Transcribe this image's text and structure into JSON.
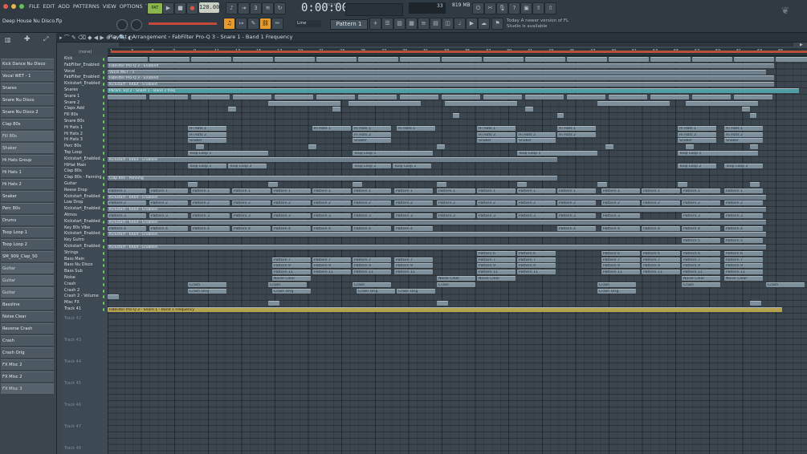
{
  "menu": [
    "FILE",
    "EDIT",
    "ADD",
    "PATTERNS",
    "VIEW",
    "OPTIONS",
    "TOOLS",
    "HELP"
  ],
  "transport": {
    "tempo": "120.000",
    "time": "0:00:00",
    "time_small": "m:s:cs",
    "mode_label": "Line",
    "pattern": "Pattern 1",
    "memory": "819 MB",
    "cpu_value": "33"
  },
  "project_name": "Deep House Nu Disco.flp",
  "news": "Today  A newer version of FL Studio is available",
  "playlist_title": "Playlist - Arrangement › FabFilter Pro-Q 3 - Snare 1 - Band 1 Frequency",
  "playlist_zoom": "(none)",
  "browser_items": [
    {
      "label": "Kick Dance Nu Disco",
      "wave": false
    },
    {
      "label": "Vocal WET - 1",
      "wave": false
    },
    {
      "label": "Snares",
      "wave": false
    },
    {
      "label": "Snare Nu Disco",
      "wave": false
    },
    {
      "label": "Snare Nu Disco 2",
      "wave": false
    },
    {
      "label": "Clap 80s",
      "wave": false
    },
    {
      "label": "Fill 80s",
      "wave": true
    },
    {
      "label": "Shaker",
      "wave": true
    },
    {
      "label": "Hi Hats Group",
      "wave": false
    },
    {
      "label": "Hi Hats 1",
      "wave": false
    },
    {
      "label": "Hi Hats 2",
      "wave": false
    },
    {
      "label": "Snaker",
      "wave": false
    },
    {
      "label": "Perc 80s",
      "wave": false
    },
    {
      "label": "Drums",
      "wave": false
    },
    {
      "label": "Toop Loop 1",
      "wave": false
    },
    {
      "label": "Toop Loop 2",
      "wave": false
    },
    {
      "label": "SM_909_Clap_50",
      "wave": false
    },
    {
      "label": "Guitar",
      "wave": true
    },
    {
      "label": "Guitar",
      "wave": true
    },
    {
      "label": "Guitar",
      "wave": true
    },
    {
      "label": "Bassline",
      "wave": false
    },
    {
      "label": "Noise Clear",
      "wave": false
    },
    {
      "label": "Reverse Crash",
      "wave": false
    },
    {
      "label": "Crash",
      "wave": false
    },
    {
      "label": "Crash Orig",
      "wave": false
    },
    {
      "label": "FX Misc 2",
      "wave": false
    },
    {
      "label": "FX Misc 2",
      "wave": false
    },
    {
      "label": "FX Misc 3",
      "wave": true
    }
  ],
  "bars": [
    "1",
    "3",
    "5",
    "7",
    "9",
    "11",
    "13",
    "15",
    "17",
    "19",
    "21",
    "23",
    "25",
    "27",
    "29",
    "31",
    "33",
    "35",
    "37",
    "39",
    "41",
    "43",
    "45",
    "47",
    "49",
    "51",
    "53",
    "55",
    "57",
    "59",
    "61",
    "63",
    "65"
  ],
  "tracks": [
    "Kick",
    "FabFilter_Enabled",
    "Vocal",
    "FabFilter_Enabled",
    "Kickstart_Enabled",
    "Snares",
    "Snare 1",
    "Snare 2",
    "Claps Add",
    "Fill 80s",
    "Snare 80s",
    "Hi Hats 1",
    "Hi Hats 2",
    "Hi Hats 3",
    "Perc 80s",
    "Top Loop",
    "Kickstart_Enabled",
    "HiHat Main",
    "Clap 80s",
    "Clap 80s - Panning",
    "Guitar",
    "Reese Drop",
    "Kickstart_Enabled",
    "Low Drop",
    "Kickstart_Enabled",
    "Atmos",
    "Kickstart_Enabled",
    "Key 80s Vibe",
    "Kickstart_Enabled",
    "Key Gutro",
    "Kickstart_Enabled",
    "Strings",
    "Bass Main",
    "Bass Nu Disco",
    "Bass Sub",
    "Noise",
    "Crash",
    "Crash 2",
    "Crash 2 - Volume",
    "Misc FX",
    "Track 41"
  ],
  "empty_tracks": [
    "Track 42",
    "Track 43",
    "Track 44",
    "Track 45",
    "Track 46",
    "Track 47",
    "Track 48"
  ],
  "clips": {
    "fabfilter": "FabFilter Pro-Q 3 - Enabled",
    "vocal": "Vocal WET - 1",
    "kickstart": "Kickstart - 64bit - Enabled",
    "param": "Param. EQ 2 - Snare 1 - Band 2 freq",
    "hihats1": "Hi Hats 1",
    "hihats2": "Hi Hats 2",
    "snaker": "Snaker",
    "toop1": "Toop Loop 1",
    "toop2": "Toop Loop 2",
    "clap_pan": "Clap 80s - Panning",
    "pattern1": "Pattern 1",
    "pattern2": "Pattern 2",
    "pattern3": "Pattern 3",
    "pattern4": "Pattern 4",
    "pattern5": "Pattern 5",
    "pattern6": "Pattern 6",
    "pattern7": "Pattern 7",
    "pattern8": "Pattern 8",
    "pattern9": "Pattern 9",
    "pattern10": "Pattern 10",
    "pattern11": "Pattern 11",
    "pattern12": "Pattern 12",
    "noise": "Noise Clear",
    "crash": "Crash",
    "crash_orig": "Crash Orig",
    "crash_vol": "Crash 2 - Volume",
    "snare_freq": "FabFilter Pro-Q 3 - Snare 1 - Band 1 Frequency"
  },
  "colors": {
    "accent": "#4f9ea3",
    "highlight_clip": "#b5a24f",
    "loop": "#b8513c"
  }
}
